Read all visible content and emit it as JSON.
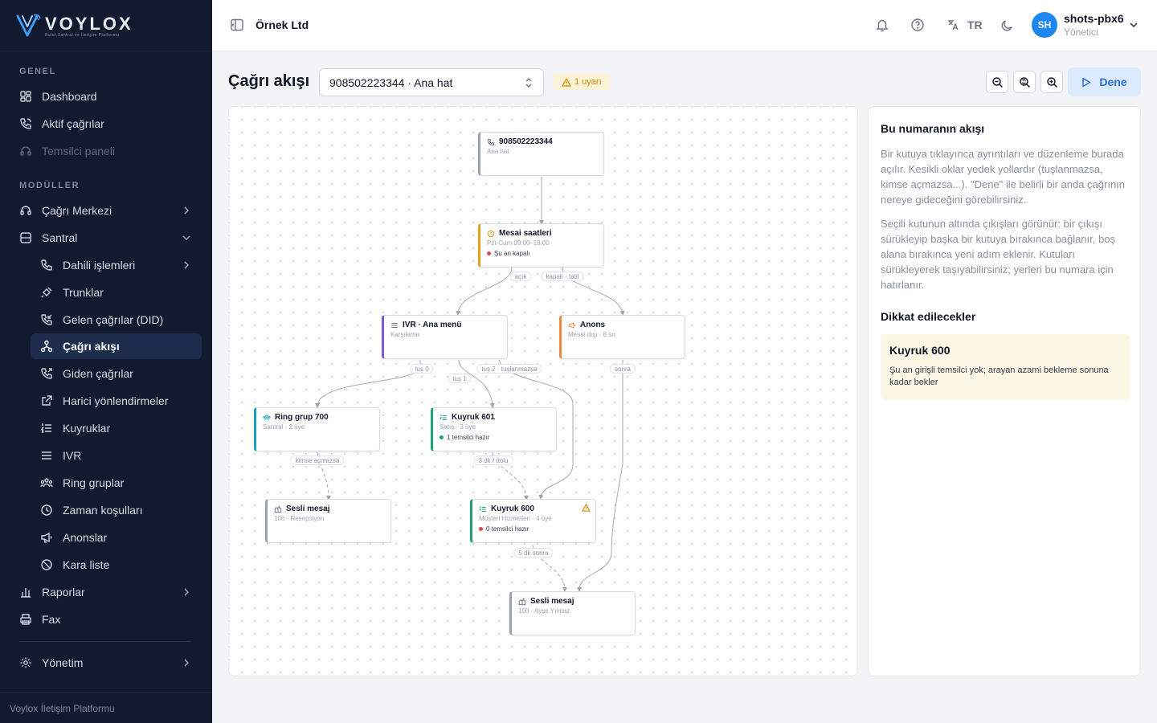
{
  "brand": {
    "name": "VOYLOX",
    "tagline": "Bulut Santral ve İletişim Platformu"
  },
  "sidebar": {
    "section_general": "GENEL",
    "section_modules": "MODÜLLER",
    "items": {
      "dashboard": "Dashboard",
      "active_calls": "Aktif çağrılar",
      "agent_panel": "Temsilci paneli",
      "call_center": "Çağrı Merkezi",
      "pbx": "Santral",
      "extensions": "Dahili işlemleri",
      "trunks": "Trunklar",
      "did": "Gelen çağrılar (DID)",
      "call_flow": "Çağrı akışı",
      "outbound": "Giden çağrılar",
      "external": "Harici yönlendirmeler",
      "queues": "Kuyruklar",
      "ivr": "IVR",
      "ring_groups": "Ring gruplar",
      "time_conditions": "Zaman koşulları",
      "announcements": "Anonslar",
      "blacklist": "Kara liste",
      "reports": "Raporlar",
      "fax": "Fax",
      "admin": "Yönetim"
    },
    "footer": "Voylox İletişim Platformu"
  },
  "topbar": {
    "company": "Örnek Ltd",
    "language": "TR",
    "avatar_initials": "SH",
    "user_name": "shots-pbx6",
    "user_role": "Yönetici"
  },
  "header": {
    "title": "Çağrı akışı",
    "number_select": "908502223344 · Ana hat",
    "warning": "1 uyarı",
    "try_button": "Dene"
  },
  "flow": {
    "nodes": {
      "root": {
        "title": "908502223344",
        "sub": "Ana hat"
      },
      "hours": {
        "title": "Mesai saatleri",
        "sub": "Pzt-Cum 09:00–18:00",
        "status": "Şu an kapalı"
      },
      "ivr": {
        "title": "IVR · Ana menü",
        "sub": "Karşılama"
      },
      "announce": {
        "title": "Anons",
        "sub": "Mesai dışı · 8 sn"
      },
      "ring700": {
        "title": "Ring grup 700",
        "sub": "Santral · 2 üye"
      },
      "queue601": {
        "title": "Kuyruk 601",
        "sub": "Satış · 3 üye",
        "status": "1 temsilci hazır"
      },
      "vm106": {
        "title": "Sesli mesaj",
        "sub": "106 · Resepsiyon"
      },
      "queue600": {
        "title": "Kuyruk 600",
        "sub": "Müşteri Hizmetleri · 4 üye",
        "status": "0 temsilci hazır"
      },
      "vm100": {
        "title": "Sesli mesaj",
        "sub": "100 · Ayşe Yılmaz"
      }
    },
    "edge_labels": {
      "open": "açık",
      "closed": "kapalı · tatil",
      "key0": "tuş 0",
      "key1": "tuş 1",
      "key2": "tuş 2 · tuşlanmazsa",
      "after": "sonra",
      "no_answer": "kimse açmazsa",
      "timeout": "3 dk / dolu",
      "after5": "5 dk sonra"
    }
  },
  "panel": {
    "title": "Bu numaranın akışı",
    "p1": "Bir kutuya tıklayınca ayrıntıları ve düzenleme burada açılır. Kesikli oklar yedek yollardır (tuşlanmazsa, kimse açmazsa...). \"Dene\" ile belirli bir anda çağrının nereye gideceğini görebilirsiniz.",
    "p2": "Seçili kutunun altında çıkışları görünür: bir çıkışı sürükleyip başka bir kutuya bırakınca bağlanır, boş alana bırakınca yeni adım eklenir. Kutuları sürükleyerek taşıyabilirsiniz; yerleri bu numara için hatırlanır.",
    "subtitle": "Dikkat edilecekler",
    "alert_title": "Kuyruk 600",
    "alert_text": "Şu an girişli temsilci yok; arayan azami bekleme sonuna kadar bekler"
  },
  "colors": {
    "sidebar_bg": "#111a2e",
    "accent": "#1d86f2",
    "warning": "#d08700",
    "ivr": "#7c5cd6",
    "announce": "#ef8a3c",
    "ring": "#16a5b8",
    "queue": "#1aa37a",
    "voicemail": "#9ca3af",
    "danger": "#e5484d"
  }
}
